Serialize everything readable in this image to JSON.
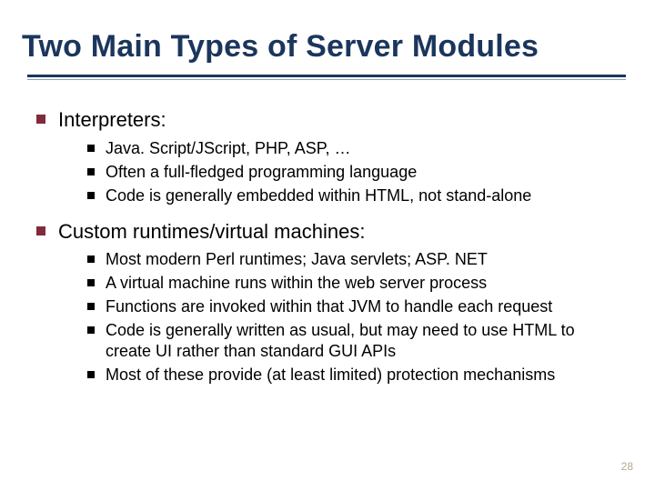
{
  "title": "Two Main Types of Server Modules",
  "sections": [
    {
      "heading": "Interpreters:",
      "items": [
        "Java. Script/JScript, PHP, ASP, …",
        "Often a full-fledged programming language",
        "Code is generally embedded within HTML, not stand-alone"
      ]
    },
    {
      "heading": "Custom runtimes/virtual machines:",
      "items": [
        "Most modern Perl runtimes; Java servlets; ASP. NET",
        "A virtual machine runs within the web server process",
        "Functions are invoked within that JVM to handle each request",
        "Code is generally written as usual, but may need to use HTML to create UI rather than standard GUI APIs",
        "Most of these provide (at least limited) protection mechanisms"
      ]
    }
  ],
  "page_number": "28"
}
